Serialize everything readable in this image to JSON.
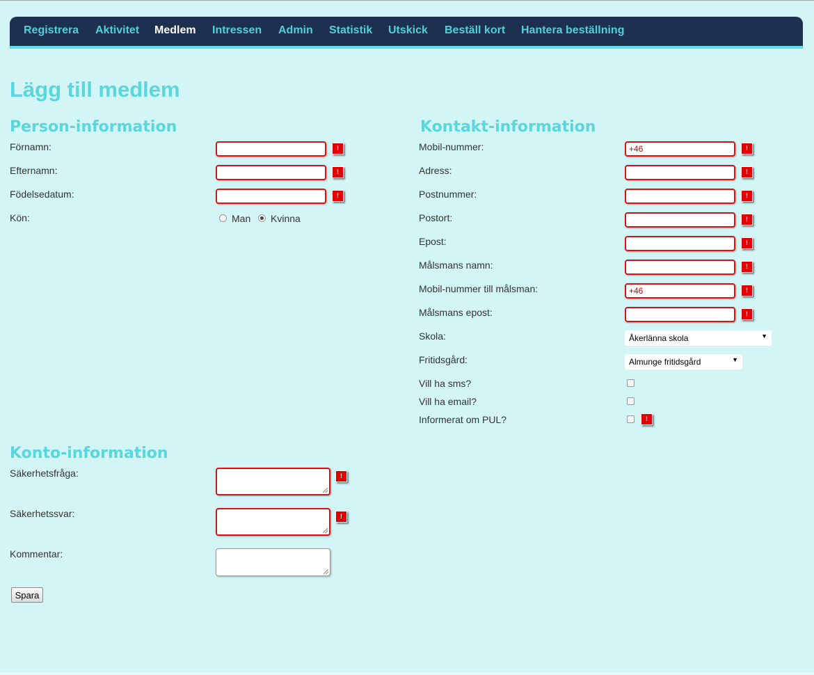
{
  "nav": {
    "items": [
      {
        "label": "Registrera"
      },
      {
        "label": "Aktivitet"
      },
      {
        "label": "Medlem"
      },
      {
        "label": "Intressen"
      },
      {
        "label": "Admin"
      },
      {
        "label": "Statistik"
      },
      {
        "label": "Utskick"
      },
      {
        "label": "Beställ kort"
      },
      {
        "label": "Hantera beställning"
      }
    ],
    "active": "Medlem"
  },
  "page": {
    "title": "Lägg till medlem"
  },
  "person": {
    "heading": "Person-information",
    "first_name_label": "Förnamn:",
    "last_name_label": "Efternamn:",
    "birth_label": "Födelsedatum:",
    "gender_label": "Kön:",
    "gender_options": [
      "Man",
      "Kvinna"
    ],
    "gender_selected": "Kvinna"
  },
  "contact": {
    "heading": "Kontakt-information",
    "mobile_label": "Mobil-nummer:",
    "mobile_value": "+46",
    "address_label": "Adress:",
    "postcode_label": "Postnummer:",
    "city_label": "Postort:",
    "email_label": "Epost:",
    "guardian_name_label": "Målsmans namn:",
    "guardian_mobile_label": "Mobil-nummer till målsman:",
    "guardian_mobile_value": "+46",
    "guardian_email_label": "Målsmans epost:",
    "school_label": "Skola:",
    "school_value": "Åkerlänna skola",
    "youth_center_label": "Fritidsgård:",
    "youth_center_value": "Almunge fritidsgård",
    "sms_label": "Vill ha sms?",
    "email_pref_label": "Vill ha email?",
    "pul_label": "Informerat om PUL?"
  },
  "account": {
    "heading": "Konto-information",
    "question_label": "Säkerhetsfråga:",
    "answer_label": "Säkerhetssvar:",
    "comment_label": "Kommentar:"
  },
  "actions": {
    "save_label": "Spara"
  },
  "required_marker": "!",
  "colors": {
    "nav_bg": "#1d304f",
    "nav_link": "#4fd0da",
    "heading": "#5ad6dd",
    "page_bg": "#d3f5f5",
    "required": "#e00000"
  }
}
